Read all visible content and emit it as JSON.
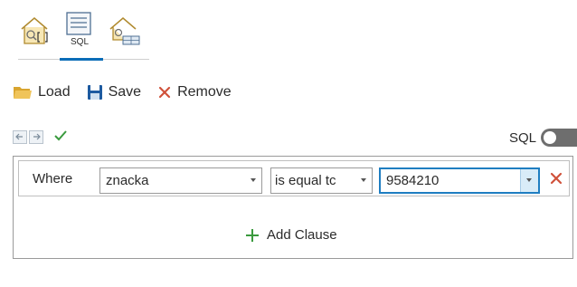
{
  "mode_tabs": {
    "items": [
      {
        "name": "clause-mode",
        "icon": "clause-house-icon"
      },
      {
        "name": "sql-mode",
        "icon": "sql-document-icon",
        "label": "SQL",
        "active": true
      },
      {
        "name": "table-mode",
        "icon": "table-pencil-icon"
      }
    ]
  },
  "toolbar": {
    "load_label": "Load",
    "save_label": "Save",
    "remove_label": "Remove"
  },
  "controls": {
    "sql_label": "SQL",
    "sql_toggle_on": false
  },
  "clause": {
    "where_label": "Where",
    "field_value": "znacka",
    "operator_value": "is equal tc",
    "value_value": "9584210"
  },
  "add_clause_label": "Add Clause",
  "colors": {
    "accent": "#0b6db8",
    "remove_red": "#d0513a",
    "check_green": "#3a9a3e",
    "add_green": "#3a9a3e",
    "folder_yellow": "#e2b23a",
    "save_blue": "#1d5aa0"
  }
}
